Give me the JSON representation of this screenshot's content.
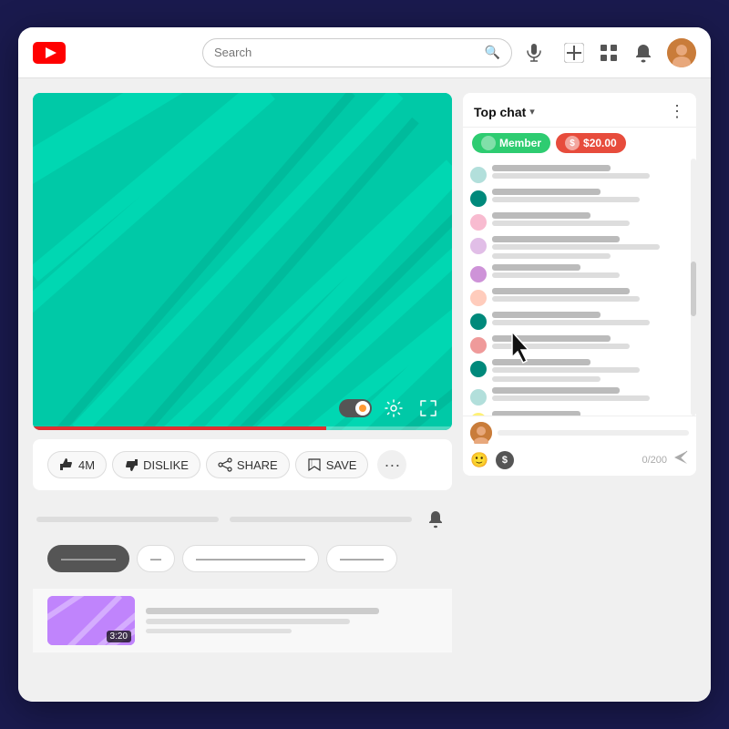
{
  "topbar": {
    "search_placeholder": "Search",
    "create_label": "Create",
    "apps_label": "Apps",
    "notifications_label": "Notifications",
    "avatar_label": "User avatar"
  },
  "video": {
    "like_count": "4M",
    "like_label": "LIKE",
    "dislike_label": "DISLIKE",
    "share_label": "SHARE",
    "save_label": "SAVE",
    "progress_percent": 70
  },
  "chat": {
    "title": "Top chat",
    "chevron": "▾",
    "more_icon": "⋮",
    "badge_member": "Member",
    "badge_dollar": "$20.00",
    "char_count": "0/200",
    "messages": [
      {
        "avatar_color": "#b2dfdb",
        "name_width": "60%",
        "text_widths": [
          "80%"
        ]
      },
      {
        "avatar_color": "#00897b",
        "name_width": "55%",
        "text_widths": [
          "75%"
        ]
      },
      {
        "avatar_color": "#f8bbd0",
        "name_width": "50%",
        "text_widths": [
          "70%"
        ]
      },
      {
        "avatar_color": "#e1bee7",
        "name_width": "65%",
        "text_widths": [
          "85%",
          "60%"
        ]
      },
      {
        "avatar_color": "#ce93d8",
        "name_width": "45%",
        "text_widths": [
          "65%"
        ]
      },
      {
        "avatar_color": "#ffccbc",
        "name_width": "70%",
        "text_widths": [
          "75%"
        ]
      },
      {
        "avatar_color": "#00897b",
        "name_width": "55%",
        "text_widths": [
          "80%"
        ]
      },
      {
        "avatar_color": "#ef9a9a",
        "name_width": "60%",
        "text_widths": [
          "70%"
        ]
      },
      {
        "avatar_color": "#00897b",
        "name_width": "50%",
        "text_widths": [
          "75%",
          "55%"
        ]
      },
      {
        "avatar_color": "#b2dfdb",
        "name_width": "65%",
        "text_widths": [
          "80%"
        ]
      },
      {
        "avatar_color": "#fff176",
        "name_width": "45%",
        "text_widths": [
          "60%"
        ]
      },
      {
        "avatar_color": "#ce93d8",
        "name_width": "55%",
        "text_widths": [
          "70%"
        ]
      }
    ]
  },
  "pill_buttons": [
    {
      "label": "—————",
      "active": true
    },
    {
      "label": "—",
      "active": false
    },
    {
      "label": "——————————",
      "active": false
    },
    {
      "label": "————",
      "active": false
    }
  ],
  "recommended": {
    "duration": "3:20",
    "title_bar_width": "80%",
    "sub_bar_width": "60%",
    "tiny_bar_width": "45%"
  }
}
